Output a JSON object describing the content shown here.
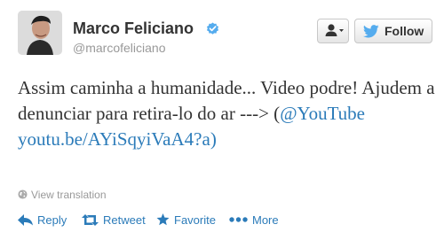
{
  "header": {
    "display_name": "Marco Feliciano",
    "handle": "@marcofeliciano",
    "follow_label": "Follow"
  },
  "tweet": {
    "text_before_link": "Assim caminha a humanidade... Video podre! Ajudem a denunciar para retira-lo do ar ---> (",
    "mention": "@YouTube",
    "url": "youtu.be/AYiSqyiVaA4",
    "after_url": "?a)"
  },
  "translation_label": "View translation",
  "actions": {
    "reply": "Reply",
    "retweet": "Retweet",
    "favorite": "Favorite",
    "more": "More"
  },
  "colors": {
    "link": "#2b7bb9",
    "verified": "#55acee",
    "muted": "#999999"
  },
  "icons": [
    "avatar",
    "verified-badge-icon",
    "user-dropdown-icon",
    "twitter-bird-icon",
    "globe-icon",
    "reply-icon",
    "retweet-icon",
    "star-icon",
    "more-dots-icon"
  ]
}
